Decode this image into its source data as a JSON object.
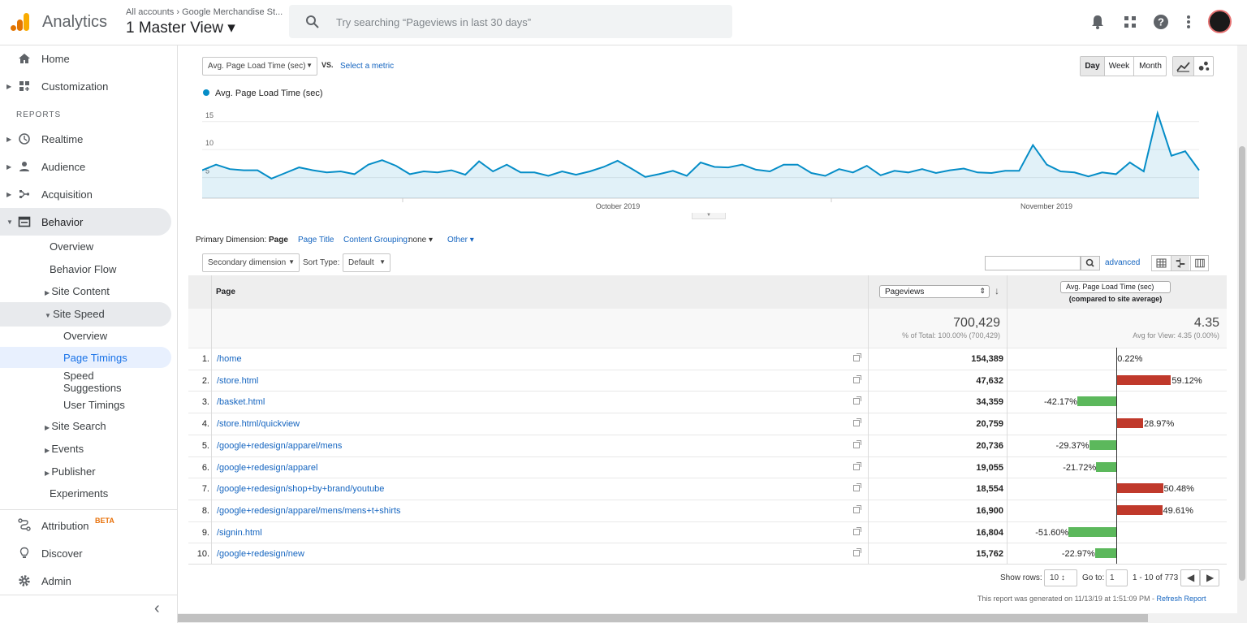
{
  "header": {
    "product": "Analytics",
    "account_path": "All accounts › Google Merchandise St...",
    "view": "1 Master View ▾",
    "search_placeholder": "Try searching “Pageviews in last 30 days”"
  },
  "sidebar": {
    "home": "Home",
    "customization": "Customization",
    "reports_label": "REPORTS",
    "realtime": "Realtime",
    "audience": "Audience",
    "acquisition": "Acquisition",
    "behavior": "Behavior",
    "overview": "Overview",
    "behavior_flow": "Behavior Flow",
    "site_content": "Site Content",
    "site_speed": "Site Speed",
    "ss_overview": "Overview",
    "page_timings": "Page Timings",
    "speed_sugg_1": "Speed",
    "speed_sugg_2": "Suggestions",
    "user_timings": "User Timings",
    "site_search": "Site Search",
    "events": "Events",
    "publisher": "Publisher",
    "experiments": "Experiments",
    "attribution": "Attribution",
    "beta": "BETA",
    "discover": "Discover",
    "admin": "Admin",
    "collapse": "‹"
  },
  "chart_controls": {
    "metric": "Avg. Page Load Time (sec)",
    "vs": "VS.",
    "select_metric": "Select a metric",
    "day": "Day",
    "week": "Week",
    "month": "Month"
  },
  "chart_data": {
    "type": "line",
    "series": [
      {
        "name": "Avg. Page Load Time (sec)",
        "color": "#058dc7",
        "values": [
          5,
          6,
          5.2,
          5,
          5,
          3.5,
          4.5,
          5.5,
          5,
          4.6,
          4.8,
          4.3,
          6,
          6.8,
          5.8,
          4.3,
          4.8,
          4.6,
          5,
          4.2,
          6.6,
          4.8,
          6,
          4.6,
          4.6,
          4,
          4.8,
          4.2,
          4.8,
          5.6,
          6.7,
          5.3,
          3.8,
          4.3,
          4.9,
          4,
          6.4,
          5.6,
          5.5,
          6,
          5.1,
          4.8,
          6,
          6,
          4.5,
          4,
          5.2,
          4.6,
          5.8,
          4.1,
          4.9,
          4.6,
          5.2,
          4.5,
          5,
          5.3,
          4.6,
          4.5,
          4.9,
          4.9,
          9.5,
          6,
          4.8,
          4.6,
          3.9,
          4.6,
          4.3,
          6.4,
          4.8,
          15.2,
          7.6,
          8.4,
          5
        ]
      }
    ],
    "x_labels": [
      "October 2019",
      "November 2019"
    ],
    "y_ticks": [
      "15",
      "10",
      "5"
    ],
    "ylim": [
      0,
      17
    ]
  },
  "dimensions": {
    "primary_label": "Primary Dimension:",
    "page": "Page",
    "page_title": "Page Title",
    "content_grouping": "Content Grouping:",
    "cg_value": "none ▾",
    "other": "Other ▾"
  },
  "toolbar": {
    "secondary": "Secondary dimension",
    "sort_type": "Sort Type:",
    "sort_value": "Default",
    "advanced": "advanced"
  },
  "table": {
    "col_page": "Page",
    "col_pageviews": "Pageviews",
    "col_metric": "Avg. Page Load Time (sec)",
    "col_metric_sub": "(compared to site average)",
    "total_pv": "700,429",
    "total_pv_sub": "% of Total: 100.00% (700,429)",
    "total_metric": "4.35",
    "total_metric_sub": "Avg for View: 4.35 (0.00%)",
    "rows": [
      {
        "n": "1.",
        "page": "/home",
        "pv": "154,389",
        "pct": "0.22%",
        "val": 0.22
      },
      {
        "n": "2.",
        "page": "/store.html",
        "pv": "47,632",
        "pct": "59.12%",
        "val": 59.12
      },
      {
        "n": "3.",
        "page": "/basket.html",
        "pv": "34,359",
        "pct": "-42.17%",
        "val": -42.17
      },
      {
        "n": "4.",
        "page": "/store.html/quickview",
        "pv": "20,759",
        "pct": "28.97%",
        "val": 28.97
      },
      {
        "n": "5.",
        "page": "/google+redesign/apparel/mens",
        "pv": "20,736",
        "pct": "-29.37%",
        "val": -29.37
      },
      {
        "n": "6.",
        "page": "/google+redesign/apparel",
        "pv": "19,055",
        "pct": "-21.72%",
        "val": -21.72
      },
      {
        "n": "7.",
        "page": "/google+redesign/shop+by+brand/youtube",
        "pv": "18,554",
        "pct": "50.48%",
        "val": 50.48
      },
      {
        "n": "8.",
        "page": "/google+redesign/apparel/mens/mens+t+shirts",
        "pv": "16,900",
        "pct": "49.61%",
        "val": 49.61
      },
      {
        "n": "9.",
        "page": "/signin.html",
        "pv": "16,804",
        "pct": "-51.60%",
        "val": -51.6
      },
      {
        "n": "10.",
        "page": "/google+redesign/new",
        "pv": "15,762",
        "pct": "-22.97%",
        "val": -22.97
      }
    ]
  },
  "footer": {
    "show_rows": "Show rows:",
    "rows_val": "10 ↕",
    "goto": "Go to:",
    "goto_val": "1",
    "range": "1 - 10 of 773",
    "generated": "This report was generated on 11/13/19 at 1:51:09 PM - ",
    "refresh": "Refresh Report"
  }
}
